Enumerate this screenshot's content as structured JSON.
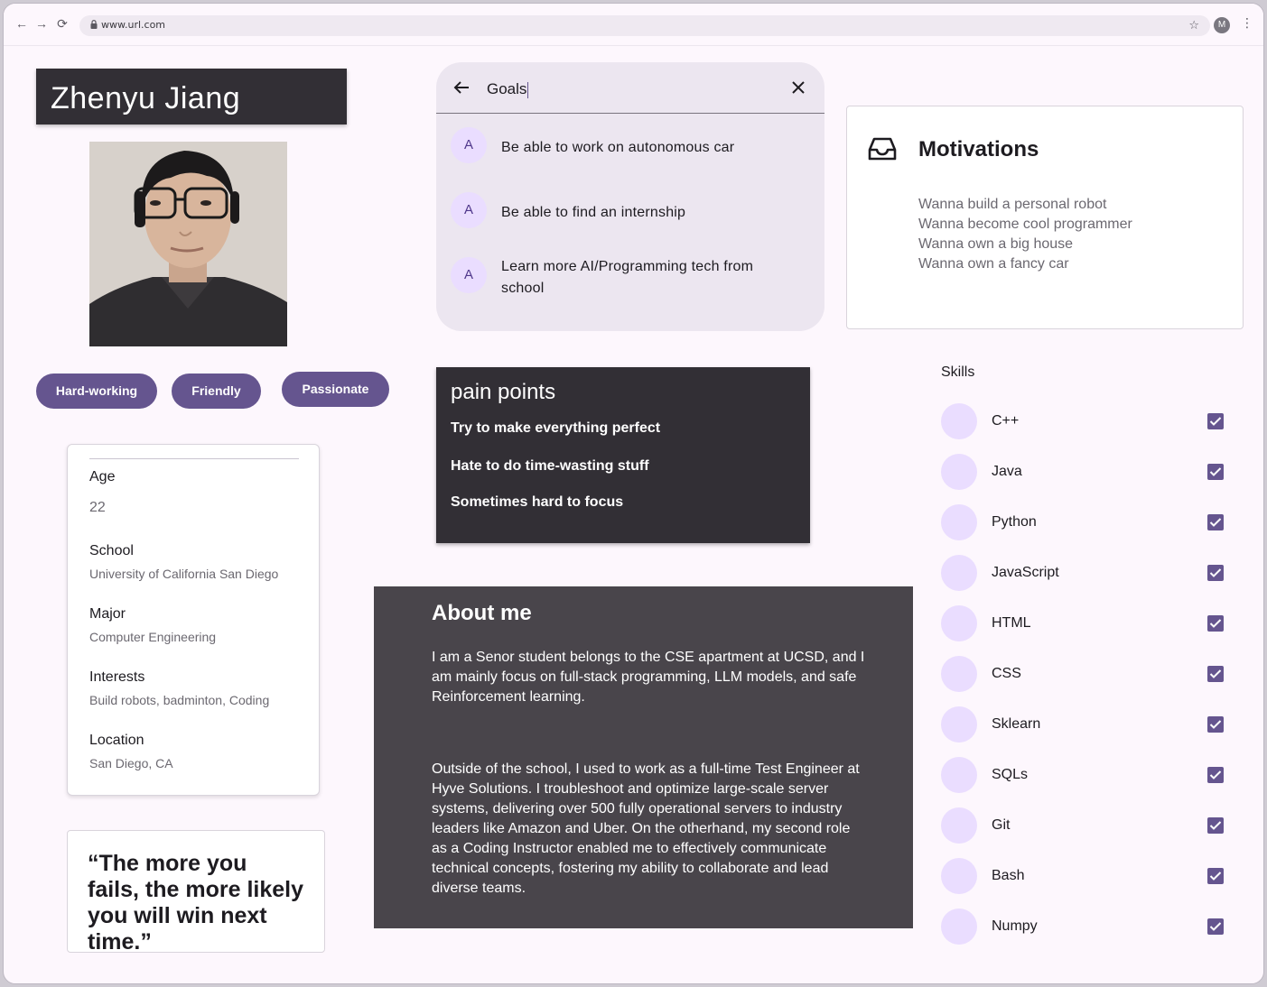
{
  "browser": {
    "url": "www.url.com",
    "profile_initial": "M"
  },
  "profile": {
    "name": "Zhenyu Jiang",
    "traits": [
      "Hard-working",
      "Friendly",
      "Passionate"
    ]
  },
  "info": {
    "age_label": "Age",
    "age_value": "22",
    "school_label": "School",
    "school_value": "University of California San Diego",
    "major_label": "Major",
    "major_value": "Computer Engineering",
    "interests_label": "Interests",
    "interests_value": "Build robots, badminton, Coding",
    "location_label": "Location",
    "location_value": "San Diego, CA"
  },
  "quote": "“The more you fails, the more likely you will win next time.”",
  "goals": {
    "query": "Goals",
    "items": [
      {
        "avatar": "A",
        "text": "Be able to work on autonomous car"
      },
      {
        "avatar": "A",
        "text": "Be able to find an internship"
      },
      {
        "avatar": "A",
        "text": "Learn more AI/Programming tech from school"
      }
    ]
  },
  "pain_points": {
    "title": "pain points",
    "items": [
      "Try to make everything perfect",
      "Hate to do time-wasting stuff",
      "Sometimes hard to focus"
    ]
  },
  "about": {
    "title": "About me",
    "para1": "I am a Senor student belongs to the CSE apartment at UCSD, and I am mainly focus on full-stack programming, LLM models, and safe Reinforcement learning.",
    "para2": "Outside of the school,  I used to work as a full-time Test Engineer at Hyve Solutions. I troubleshoot and  optimize large-scale server systems, delivering over 500 fully operational servers to industry  leaders like Amazon and Uber. On the otherhand, my second role as a Coding Instructor enabled me to  effectively communicate technical concepts, fostering my ability to collaborate and lead diverse teams."
  },
  "motivations": {
    "title": "Motivations",
    "items": [
      "Wanna build a personal robot",
      "Wanna become cool programmer",
      "Wanna own a big house",
      "Wanna own a fancy car"
    ]
  },
  "skills": {
    "heading": "Skills",
    "items": [
      {
        "label": "C++",
        "checked": true
      },
      {
        "label": "Java",
        "checked": true
      },
      {
        "label": "Python",
        "checked": true
      },
      {
        "label": "JavaScript",
        "checked": true
      },
      {
        "label": "HTML",
        "checked": true
      },
      {
        "label": "CSS",
        "checked": true
      },
      {
        "label": "Sklearn",
        "checked": true
      },
      {
        "label": "SQLs",
        "checked": true
      },
      {
        "label": "Git",
        "checked": true
      },
      {
        "label": "Bash",
        "checked": true
      },
      {
        "label": "Numpy",
        "checked": true
      }
    ]
  },
  "colors": {
    "primary": "#65558f",
    "dark_card": "#322f35",
    "about_bg": "#49454b",
    "avatar_bg": "#eaddff"
  }
}
